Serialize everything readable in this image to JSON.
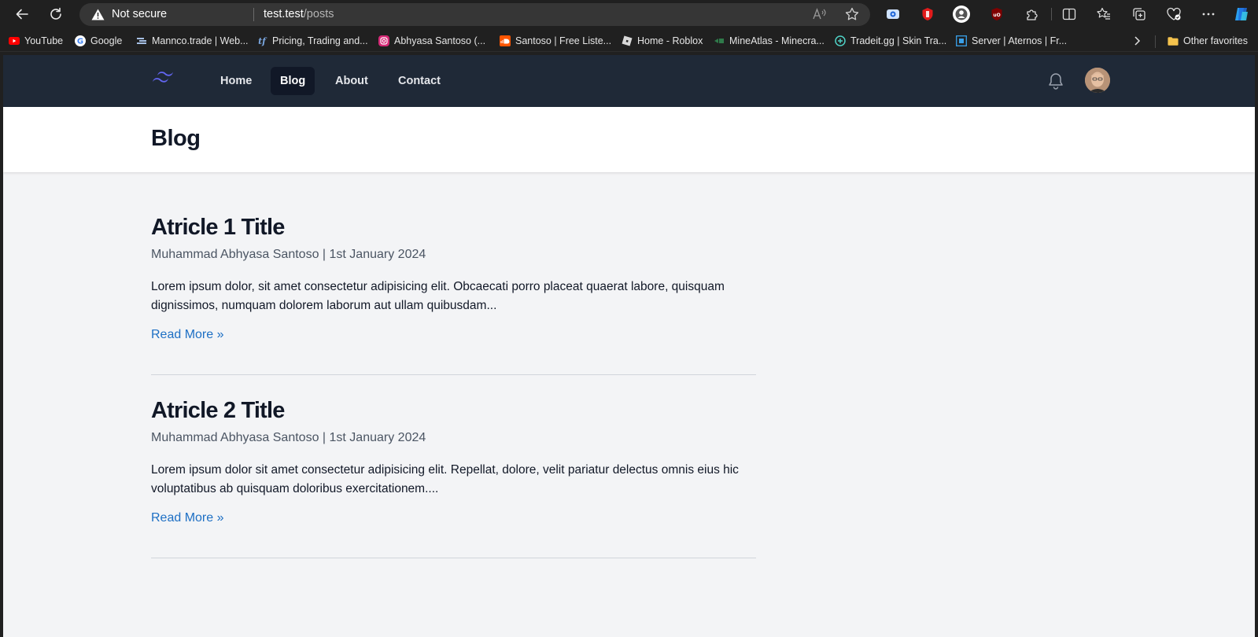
{
  "browser": {
    "security_status": "Not secure",
    "url_host": "test.test",
    "url_path": "/posts",
    "bookmarks": [
      {
        "label": "YouTube",
        "icon": "youtube-icon"
      },
      {
        "label": "Google",
        "icon": "google-icon"
      },
      {
        "label": "Mannco.trade | Web...",
        "icon": "mannco-icon"
      },
      {
        "label": "Pricing, Trading and...",
        "icon": "tf-icon"
      },
      {
        "label": "Abhyasa Santoso (...",
        "icon": "instagram-icon"
      },
      {
        "label": "Santoso | Free Liste...",
        "icon": "soundcloud-icon"
      },
      {
        "label": "Home - Roblox",
        "icon": "roblox-icon"
      },
      {
        "label": "MineAtlas - Minecra...",
        "icon": "mineatlas-icon"
      },
      {
        "label": "Tradeit.gg | Skin Tra...",
        "icon": "tradeit-icon"
      },
      {
        "label": "Server | Aternos | Fr...",
        "icon": "aternos-icon"
      }
    ],
    "other_favorites": "Other favorites"
  },
  "nav": {
    "links": [
      {
        "label": "Home",
        "active": false
      },
      {
        "label": "Blog",
        "active": true
      },
      {
        "label": "About",
        "active": false
      },
      {
        "label": "Contact",
        "active": false
      }
    ]
  },
  "header": {
    "title": "Blog"
  },
  "articles": [
    {
      "title": "Atricle 1 Title",
      "meta": "Muhammad Abhyasa Santoso | 1st January 2024",
      "excerpt": "Lorem ipsum dolor, sit amet consectetur adipisicing elit. Obcaecati porro placeat quaerat labore, quisquam dignissimos, numquam dolorem laborum aut ullam quibusdam...",
      "link": "Read More »"
    },
    {
      "title": "Atricle 2 Title",
      "meta": "Muhammad Abhyasa Santoso | 1st January 2024",
      "excerpt": "Lorem ipsum dolor sit amet consectetur adipisicing elit. Repellat, dolore, velit pariatur delectus omnis eius hic voluptatibus ab quisquam doloribus exercitationem....",
      "link": "Read More »"
    }
  ],
  "colors": {
    "nav_bg": "#1f2937",
    "page_bg": "#f3f4f6",
    "link": "#1d6fc4",
    "logo": "#6366f1"
  }
}
